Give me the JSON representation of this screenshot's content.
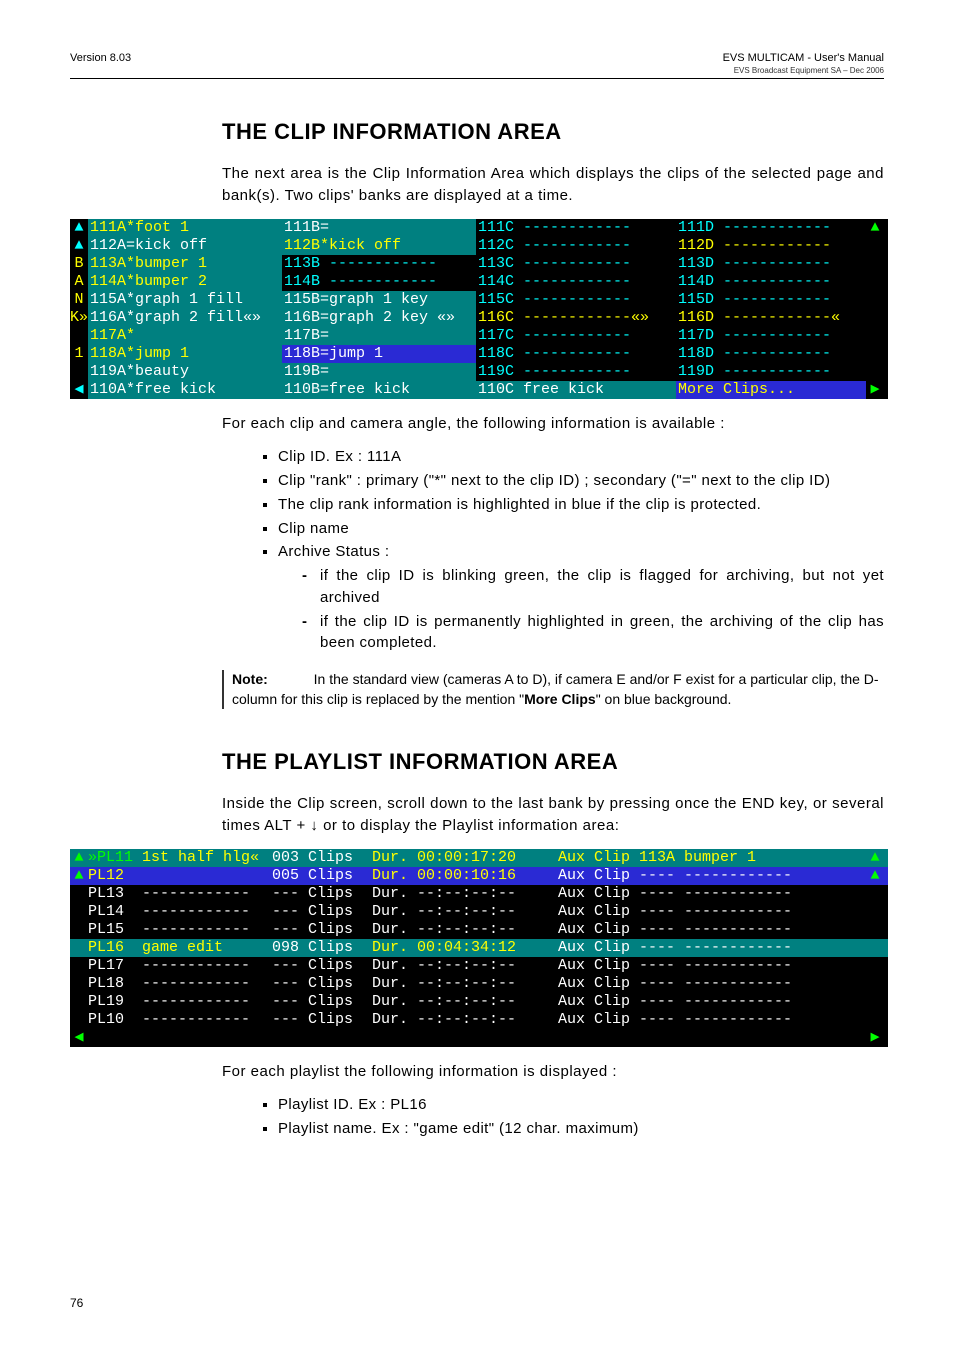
{
  "header": {
    "left": "Version 8.03",
    "right": "EVS MULTICAM  - User's Manual",
    "sub": "EVS Broadcast Equipment SA – Dec 2006"
  },
  "s1": {
    "title": "THE CLIP INFORMATION AREA",
    "intro": "The next area is the Clip Information Area which displays the clips of the selected page and bank(s). Two clips' banks are displayed at a time.",
    "after": "For each clip and camera angle, the following information is available :",
    "bul": {
      "b1": "Clip ID. Ex : 111A",
      "b2": "Clip \"rank\" : primary (\"*\" next to the clip ID) ; secondary (\"=\" next to the clip ID)",
      "b3": "The clip rank information is highlighted in blue if the clip is protected.",
      "b4": "Clip name",
      "b5": "Archive Status :",
      "b5a": "if the clip ID is blinking green, the clip is flagged for archiving, but not yet archived",
      "b5b": "if the clip ID is permanently highlighted in green, the archiving of the clip has been completed."
    },
    "note_label": "Note:",
    "note_a": "In the standard view (cameras A to D), if camera E and/or F exist for a particular clip, the D-column for this clip is replaced by the mention \"",
    "note_b": "More Clips",
    "note_c": "\" on blue background."
  },
  "clip_rows": [
    {
      "g": "▲",
      "a": "111A*foot 1",
      "ac": "bg-teal-y",
      "b": "111B=",
      "bc": "bg-teal",
      "c": "111C ------------",
      "cc": "fg-cy",
      "d": "111D ------------",
      "dc": "fg-cy",
      "rg": "▲",
      "rgc": "fg-gr"
    },
    {
      "g": "▲",
      "a": "112A=kick off",
      "ac": "bg-teal",
      "b": "112B*kick off",
      "bc": "bg-teal-y",
      "c": "112C ------------",
      "cc": "fg-cy",
      "d": "112D ------------",
      "dc": "fg-ye",
      "rg": "",
      "rgc": ""
    },
    {
      "g": "B",
      "a": "113A*bumper 1",
      "ac": "bg-teal-y",
      "b": "113B ------------",
      "bc": "fg-cy",
      "c": "113C ------------",
      "cc": "fg-cy",
      "d": "113D ------------",
      "dc": "fg-cy",
      "rg": "",
      "rgc": ""
    },
    {
      "g": "A",
      "a": "114A*bumper 2",
      "ac": "bg-teal-y",
      "b": "114B ------------",
      "bc": "fg-cy",
      "c": "114C ------------",
      "cc": "fg-cy",
      "d": "114D ------------",
      "dc": "fg-cy",
      "rg": "",
      "rgc": ""
    },
    {
      "g": "N",
      "a": "115A*graph 1 fill",
      "ac": "bg-teal",
      "b": "115B=graph 1 key",
      "bc": "bg-teal",
      "c": "115C ------------",
      "cc": "fg-cy",
      "d": "115D ------------",
      "dc": "fg-cy",
      "rg": "",
      "rgc": ""
    },
    {
      "g": "K»",
      "a": "116A*graph 2 fill«»",
      "ac": "bg-teal",
      "b": "116B=graph 2 key «»",
      "bc": "bg-teal",
      "c": "116C ------------«»",
      "cc": "fg-ye",
      "d": "116D ------------«",
      "dc": "fg-ye",
      "rg": "",
      "rgc": ""
    },
    {
      "g": "",
      "a": "117A*",
      "ac": "bg-teal-y",
      "b": "117B=",
      "bc": "bg-teal",
      "c": "117C ------------",
      "cc": "fg-cy",
      "d": "117D ------------",
      "dc": "fg-cy",
      "rg": "",
      "rgc": ""
    },
    {
      "g": "1",
      "a": "118A*jump 1",
      "ac": "bg-teal-y",
      "b": "118B=jump 1",
      "bc": "bg-blue",
      "c": "118C ------------",
      "cc": "fg-cy",
      "d": "118D ------------",
      "dc": "fg-cy",
      "rg": "",
      "rgc": ""
    },
    {
      "g": "",
      "a": "119A*beauty",
      "ac": "bg-teal",
      "b": "119B=",
      "bc": "bg-teal",
      "c": "119C ------------",
      "cc": "fg-cy",
      "d": "119D ------------",
      "dc": "fg-cy",
      "rg": "",
      "rgc": ""
    },
    {
      "g": "◀",
      "a": "110A*free kick",
      "ac": "bg-teal",
      "b": "110B=free kick",
      "bc": "bg-teal",
      "c": "110C free kick",
      "cc": "bg-teal",
      "d": "More Clips...",
      "dc": "bg-blue-y",
      "rg": "▶",
      "rgc": "fg-gr"
    }
  ],
  "s2": {
    "title": "THE PLAYLIST INFORMATION AREA",
    "intro": "Inside the Clip screen, scroll down to the last bank by pressing once the END key, or several times ALT + ↓ or  to display the Playlist information area:",
    "after": "For each playlist the following information is displayed :",
    "bul": {
      "b1": "Playlist ID. Ex : PL16",
      "b2": "Playlist name. Ex : \"game edit\" (12 char. maximum)"
    }
  },
  "pl_rows": [
    {
      "g": "▲",
      "row_c": "bg-teal2",
      "id": "»PL11",
      "idc": "fg-gr",
      "name": "1st half hlg«",
      "namec": "fg-ye",
      "clips": "003 Clips",
      "clipsc": "",
      "dur": "Dur. 00:00:17:20",
      "durc": "fg-ye",
      "aux": "Aux Clip 113A bumper 1",
      "auxc": "fg-ye",
      "rg": "▲"
    },
    {
      "g": "▲",
      "row_c": "bg-blue2",
      "id": "PL12",
      "idc": "fg-ye",
      "name": "",
      "namec": "",
      "clips": "005 Clips",
      "clipsc": "",
      "dur": "Dur. 00:00:10:16",
      "durc": "fg-ye",
      "aux": "Aux Clip ---- ------------",
      "auxc": "",
      "rg": "▲"
    },
    {
      "g": "",
      "row_c": "",
      "id": "PL13",
      "idc": "",
      "name": "------------",
      "namec": "",
      "clips": "--- Clips",
      "clipsc": "",
      "dur": "Dur. --:--:--:--",
      "durc": "",
      "aux": "Aux Clip ---- ------------",
      "auxc": "",
      "rg": ""
    },
    {
      "g": "",
      "row_c": "",
      "id": "PL14",
      "idc": "",
      "name": "------------",
      "namec": "",
      "clips": "--- Clips",
      "clipsc": "",
      "dur": "Dur. --:--:--:--",
      "durc": "",
      "aux": "Aux Clip ---- ------------",
      "auxc": "",
      "rg": ""
    },
    {
      "g": "",
      "row_c": "",
      "id": "PL15",
      "idc": "",
      "name": "------------",
      "namec": "",
      "clips": "--- Clips",
      "clipsc": "",
      "dur": "Dur. --:--:--:--",
      "durc": "",
      "aux": "Aux Clip ---- ------------",
      "auxc": "",
      "rg": ""
    },
    {
      "g": "",
      "row_c": "bg-teal2",
      "id": "PL16",
      "idc": "fg-ye",
      "name": "game edit",
      "namec": "fg-ye",
      "clips": "098 Clips",
      "clipsc": "",
      "dur": "Dur. 00:04:34:12",
      "durc": "fg-ye",
      "aux": "Aux Clip ---- ------------",
      "auxc": "",
      "rg": ""
    },
    {
      "g": "",
      "row_c": "",
      "id": "PL17",
      "idc": "",
      "name": "------------",
      "namec": "",
      "clips": "--- Clips",
      "clipsc": "",
      "dur": "Dur. --:--:--:--",
      "durc": "",
      "aux": "Aux Clip ---- ------------",
      "auxc": "",
      "rg": ""
    },
    {
      "g": "",
      "row_c": "",
      "id": "PL18",
      "idc": "",
      "name": "------------",
      "namec": "",
      "clips": "--- Clips",
      "clipsc": "",
      "dur": "Dur. --:--:--:--",
      "durc": "",
      "aux": "Aux Clip ---- ------------",
      "auxc": "",
      "rg": ""
    },
    {
      "g": "",
      "row_c": "",
      "id": "PL19",
      "idc": "",
      "name": "------------",
      "namec": "",
      "clips": "--- Clips",
      "clipsc": "",
      "dur": "Dur. --:--:--:--",
      "durc": "",
      "aux": "Aux Clip ---- ------------",
      "auxc": "",
      "rg": ""
    },
    {
      "g": "",
      "row_c": "",
      "id": "PL10",
      "idc": "",
      "name": "------------",
      "namec": "",
      "clips": "--- Clips",
      "clipsc": "",
      "dur": "Dur. --:--:--:--",
      "durc": "",
      "aux": "Aux Clip ---- ------------",
      "auxc": "",
      "rg": ""
    },
    {
      "g": "◀",
      "row_c": "",
      "id": "",
      "idc": "",
      "name": "",
      "namec": "",
      "clips": "",
      "clipsc": "",
      "dur": "",
      "durc": "",
      "aux": "",
      "auxc": "",
      "rg": "▶"
    }
  ],
  "page_num": "76"
}
